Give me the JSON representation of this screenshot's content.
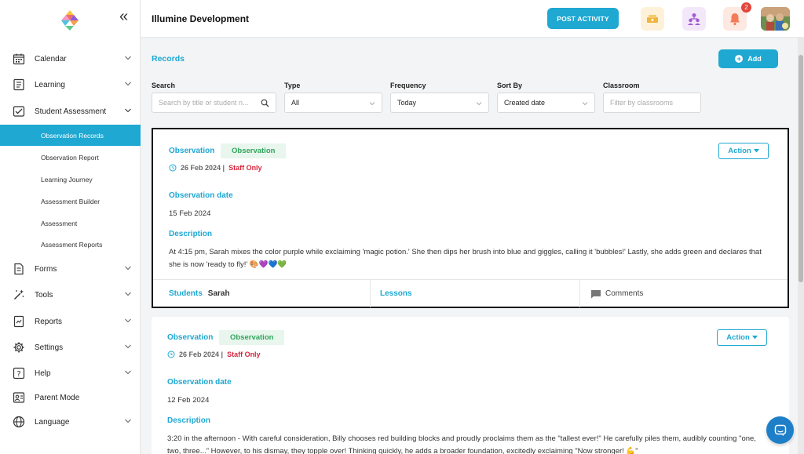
{
  "app": {
    "title": "Illumine Development"
  },
  "header": {
    "post_activity_label": "POST ACTIVITY",
    "notification_count": "2"
  },
  "sidebar": {
    "items": [
      {
        "label": "Calendar",
        "icon": "calendar-icon"
      },
      {
        "label": "Learning",
        "icon": "book-icon"
      },
      {
        "label": "Student Assessment",
        "icon": "assessment-icon"
      },
      {
        "label": "Forms",
        "icon": "form-icon"
      },
      {
        "label": "Tools",
        "icon": "wand-icon"
      },
      {
        "label": "Reports",
        "icon": "report-icon"
      },
      {
        "label": "Settings",
        "icon": "gear-icon"
      },
      {
        "label": "Help",
        "icon": "help-icon"
      },
      {
        "label": "Parent Mode",
        "icon": "parent-icon"
      },
      {
        "label": "Language",
        "icon": "globe-icon"
      }
    ],
    "sub_items": [
      {
        "label": "Observation Records",
        "active": true
      },
      {
        "label": "Observation Report"
      },
      {
        "label": "Learning Journey"
      },
      {
        "label": "Assessment Builder"
      },
      {
        "label": "Assessment"
      },
      {
        "label": "Assessment Reports"
      }
    ]
  },
  "page": {
    "title": "Records",
    "add_label": "Add"
  },
  "filters": {
    "search": {
      "label": "Search",
      "placeholder": "Search by title or student n..."
    },
    "type": {
      "label": "Type",
      "value": "All"
    },
    "frequency": {
      "label": "Frequency",
      "value": "Today"
    },
    "sort_by": {
      "label": "Sort By",
      "value": "Created date"
    },
    "classroom": {
      "label": "Classroom",
      "placeholder": "Filter by classrooms"
    }
  },
  "records": [
    {
      "type": "Observation",
      "tag": "Observation",
      "date": "26 Feb 2024 |",
      "visibility": "Staff Only",
      "action_label": "Action",
      "obs_date_label": "Observation date",
      "obs_date": "15 Feb 2024",
      "desc_label": "Description",
      "description": "At 4:15 pm, Sarah mixes the color purple while exclaiming 'magic potion.' She then dips her brush into blue and giggles, calling it 'bubbles!' Lastly, she adds green and declares that she is now 'ready to fly!' 🎨💜💙💚",
      "students_label": "Students",
      "students": "Sarah",
      "lessons_label": "Lessons",
      "comments_label": "Comments"
    },
    {
      "type": "Observation",
      "tag": "Observation",
      "date": "26 Feb 2024 |",
      "visibility": "Staff Only",
      "action_label": "Action",
      "obs_date_label": "Observation date",
      "obs_date": "12 Feb 2024",
      "desc_label": "Description",
      "description": "3:20 in the afternoon - With careful consideration, Billy chooses red building blocks and proudly proclaims them as the \"tallest ever!\" He carefully piles them, audibly counting \"one, two, three...\" However, to his dismay, they topple over! Thinking quickly, he adds a broader foundation, excitedly exclaiming \"Now stronger! 💪\""
    }
  ],
  "colors": {
    "accent": "#1ea8d2",
    "tag_bg": "#e8f6ee",
    "tag_text": "#2fa65a",
    "staff_only": "#d7263d"
  }
}
